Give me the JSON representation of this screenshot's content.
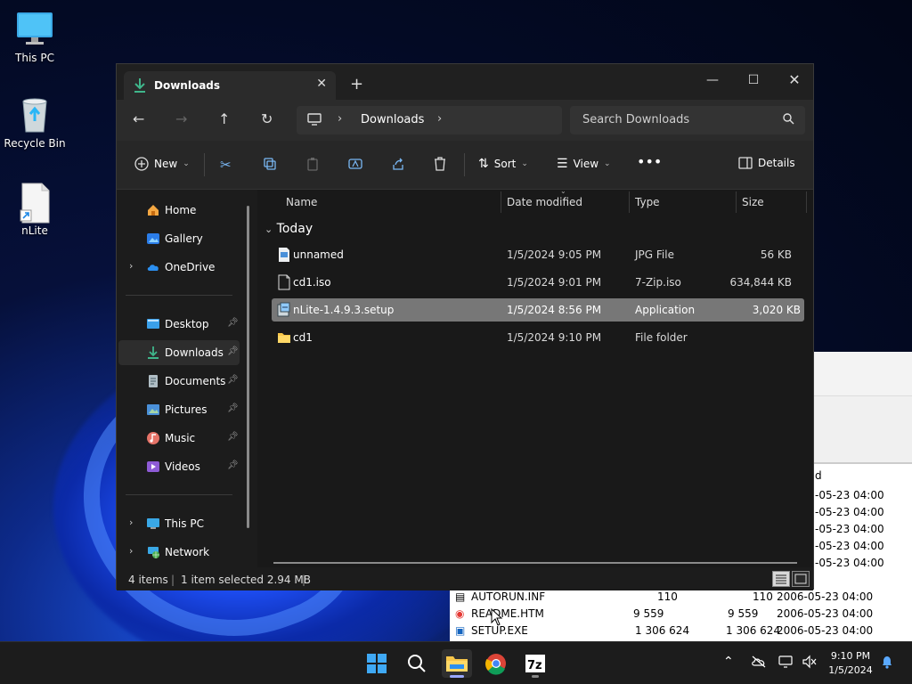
{
  "desktop": {
    "icons": [
      {
        "label": "This PC"
      },
      {
        "label": "Recycle Bin"
      },
      {
        "label": "nLite"
      }
    ]
  },
  "explorer": {
    "tab_title": "Downloads",
    "address": {
      "crumb": "Downloads"
    },
    "search": {
      "placeholder": "Search Downloads"
    },
    "toolbar": {
      "new_label": "New",
      "sort_label": "Sort",
      "view_label": "View",
      "details_label": "Details"
    },
    "sidebar": {
      "items": [
        {
          "label": "Home"
        },
        {
          "label": "Gallery"
        },
        {
          "label": "OneDrive"
        },
        {
          "label": "Desktop"
        },
        {
          "label": "Downloads"
        },
        {
          "label": "Documents"
        },
        {
          "label": "Pictures"
        },
        {
          "label": "Music"
        },
        {
          "label": "Videos"
        },
        {
          "label": "This PC"
        },
        {
          "label": "Network"
        }
      ]
    },
    "columns": {
      "name": "Name",
      "date": "Date modified",
      "type": "Type",
      "size": "Size"
    },
    "group": "Today",
    "files": [
      {
        "name": "unnamed",
        "date": "1/5/2024 9:05 PM",
        "type": "JPG File",
        "size": "56 KB"
      },
      {
        "name": "cd1.iso",
        "date": "1/5/2024 9:01 PM",
        "type": "7-Zip.iso",
        "size": "634,844 KB"
      },
      {
        "name": "nLite-1.4.9.3.setup",
        "date": "1/5/2024 8:56 PM",
        "type": "Application",
        "size": "3,020 KB"
      },
      {
        "name": "cd1",
        "date": "1/5/2024 9:10 PM",
        "type": "File folder",
        "size": ""
      }
    ],
    "status": {
      "count": "4 items",
      "selection": "1 item selected  2.94 MB"
    }
  },
  "background_window": {
    "header_fragment": "d",
    "rows": [
      {
        "name": "",
        "size": "",
        "packed": "",
        "date": "-05-23 04:00"
      },
      {
        "name": "",
        "size": "",
        "packed": "",
        "date": "-05-23 04:00"
      },
      {
        "name": "",
        "size": "",
        "packed": "",
        "date": "-05-23 04:00"
      },
      {
        "name": "",
        "size": "",
        "packed": "",
        "date": "-05-23 04:00"
      },
      {
        "name": "",
        "size": "",
        "packed": "",
        "date": "-05-23 04:00"
      },
      {
        "name": "AUTORUN.INF",
        "size": "110",
        "packed": "110",
        "date": "2006-05-23 04:00"
      },
      {
        "name": "README.HTM",
        "size": "9 559",
        "packed": "9 559",
        "date": "2006-05-23 04:00"
      },
      {
        "name": "SETUP.EXE",
        "size": "1 306 624",
        "packed": "1 306 624",
        "date": "2006-05-23 04:00"
      }
    ]
  },
  "taskbar": {
    "time": "9:10 PM",
    "date": "1/5/2024"
  },
  "colors": {
    "accent": "#0078d4",
    "selected_row": "#777777",
    "download_green": "#3fb68b"
  }
}
